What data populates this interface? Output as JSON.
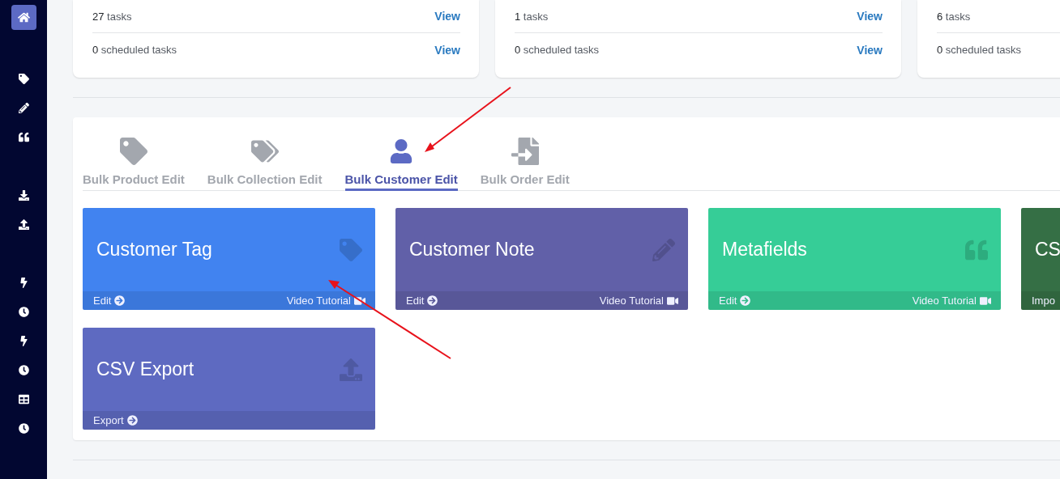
{
  "sidebar": {
    "groups": [
      [
        {
          "kind": "home",
          "selected": true
        }
      ],
      [
        {
          "kind": "tag",
          "selected": false
        },
        {
          "kind": "pencil",
          "selected": false
        },
        {
          "kind": "quote",
          "selected": false
        }
      ],
      [
        {
          "kind": "download",
          "selected": false
        },
        {
          "kind": "upload",
          "selected": false
        }
      ],
      [
        {
          "kind": "bolt",
          "selected": false
        },
        {
          "kind": "clock",
          "selected": false
        },
        {
          "kind": "bolt",
          "selected": false
        },
        {
          "kind": "clock",
          "selected": false
        },
        {
          "kind": "table",
          "selected": false
        },
        {
          "kind": "clock",
          "selected": false
        }
      ]
    ]
  },
  "summary_cards": [
    {
      "rows": [
        {
          "count": "27",
          "label": "tasks",
          "link": "View"
        },
        {
          "count": "0",
          "label": "scheduled tasks",
          "link": "View"
        }
      ]
    },
    {
      "rows": [
        {
          "count": "1",
          "label": "tasks",
          "link": "View"
        },
        {
          "count": "0",
          "label": "scheduled tasks",
          "link": "View"
        }
      ]
    },
    {
      "rows": [
        {
          "count": "6",
          "label": "tasks"
        },
        {
          "count": "0",
          "label": "scheduled tasks"
        }
      ]
    }
  ],
  "tabs": [
    {
      "kind": "tag",
      "label": "Bulk Product Edit",
      "selected": false
    },
    {
      "kind": "tags",
      "label": "Bulk Collection Edit",
      "selected": false
    },
    {
      "kind": "user",
      "label": "Bulk Customer Edit",
      "selected": true
    },
    {
      "kind": "import",
      "label": "Bulk Order Edit",
      "selected": false
    }
  ],
  "tiles": [
    {
      "kind": "tag",
      "title": "Customer Tag",
      "color": "#4183f0",
      "action": "Edit",
      "tutorial": "Video Tutorial"
    },
    {
      "kind": "pencil",
      "title": "Customer Note",
      "color": "#6160a8",
      "action": "Edit",
      "tutorial": "Video Tutorial"
    },
    {
      "kind": "quote",
      "title": "Metafields",
      "color": "#36cd97",
      "action": "Edit",
      "tutorial": "Video Tutorial"
    },
    {
      "kind": "cut",
      "title": "CS",
      "color": "#356f45",
      "action": "Impo"
    },
    {
      "kind": "upload",
      "title": "CSV Export",
      "color": "#5e6ac1",
      "action": "Export"
    }
  ]
}
